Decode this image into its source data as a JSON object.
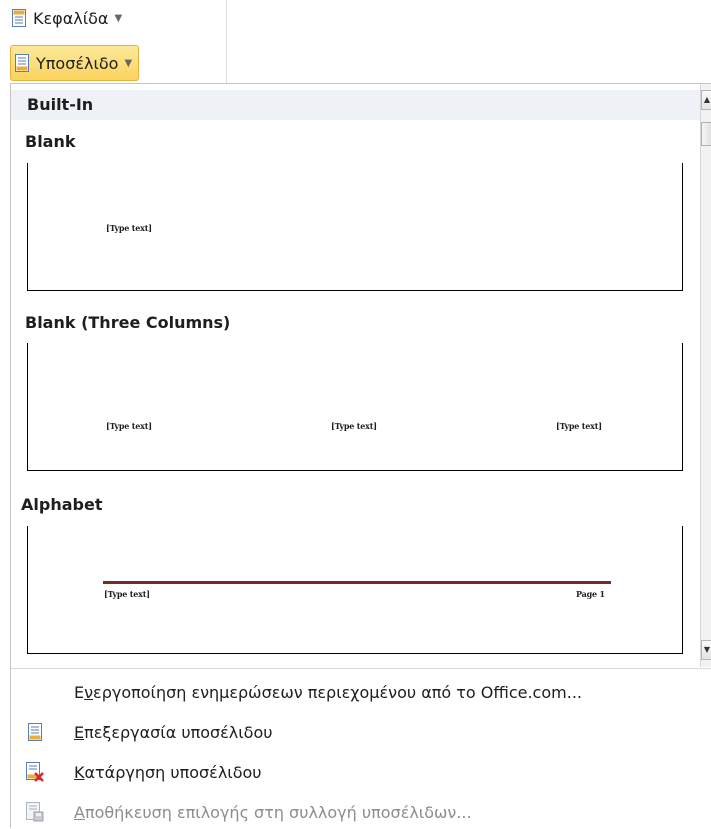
{
  "ribbon": {
    "header_button": {
      "label": "Κεφαλίδα",
      "icon": "page-header-icon"
    },
    "footer_button": {
      "label": "Υποσέλιδο",
      "icon": "page-footer-icon",
      "state": "open"
    }
  },
  "gallery": {
    "section": "Built-In",
    "items": [
      {
        "title": "Blank",
        "placeholders": [
          "[Type text]"
        ]
      },
      {
        "title": "Blank (Three Columns)",
        "placeholders": [
          "[Type text]",
          "[Type text]",
          "[Type text]"
        ]
      },
      {
        "title": "Alphabet",
        "placeholders": [
          "[Type text]"
        ],
        "page_label": "Page 1",
        "rule_color": "#7a2a25"
      }
    ]
  },
  "menu_items": [
    {
      "access_key": "",
      "prefix": "Ε",
      "key": "ν",
      "rest": "εργοποίηση ενημερώσεων περιεχομένου από το Office.com...",
      "icon": "",
      "enabled": true
    },
    {
      "prefix": "",
      "key": "Ε",
      "rest": "πεξεργασία υποσέλιδου",
      "icon": "edit-footer-icon",
      "enabled": true
    },
    {
      "prefix": "",
      "key": "Κ",
      "rest": "ατάργηση υποσέλιδου",
      "icon": "remove-footer-icon",
      "enabled": true
    },
    {
      "prefix": "",
      "key": "Α",
      "rest": "ποθήκευση επιλογής στη συλλογή υποσέλιδων...",
      "icon": "save-selection-icon",
      "enabled": false
    }
  ],
  "colors": {
    "accent_hover": "#fbd35d",
    "section_bg": "#eef1f5"
  }
}
